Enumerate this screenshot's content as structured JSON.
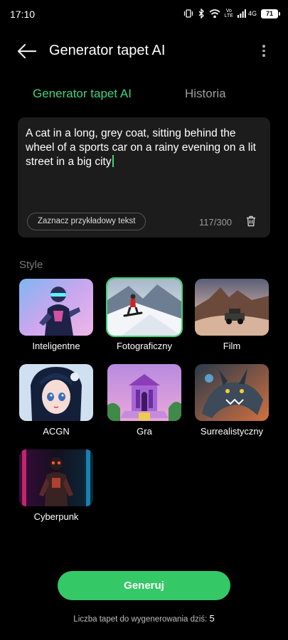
{
  "status_bar": {
    "time": "17:10",
    "volte": "Vo\nLTE",
    "network": "4G",
    "battery": "71"
  },
  "header": {
    "title": "Generator tapet AI"
  },
  "tabs": [
    {
      "label": "Generator tapet AI",
      "active": true
    },
    {
      "label": "Historia",
      "active": false
    }
  ],
  "prompt": {
    "text": "A cat in a long, grey coat, sitting behind the wheel of a sports car on a rainy evening on a lit street in a big city",
    "sample_button": "Zaznacz przykładowy tekst",
    "counter": "117/300"
  },
  "styles": {
    "label": "Style",
    "items": [
      {
        "name": "Inteligentne",
        "icon": "robot-thumbnail",
        "selected": false
      },
      {
        "name": "Fotograficzny",
        "icon": "snowboarder-thumbnail",
        "selected": true
      },
      {
        "name": "Film",
        "icon": "jeep-desert-thumbnail",
        "selected": false
      },
      {
        "name": "ACGN",
        "icon": "anime-girl-thumbnail",
        "selected": false
      },
      {
        "name": "Gra",
        "icon": "temple-thumbnail",
        "selected": false
      },
      {
        "name": "Surrealistyczny",
        "icon": "dragon-thumbnail",
        "selected": false
      },
      {
        "name": "Cyberpunk",
        "icon": "cyber-figure-thumbnail",
        "selected": false
      }
    ]
  },
  "generate": {
    "label": "Generuj",
    "quota_label": "Liczba tapet do wygenerowania dziś:",
    "quota_value": "5"
  },
  "colors": {
    "accent": "#3dd57b",
    "button": "#35c866",
    "background": "#000000",
    "card": "#1c1c1c"
  }
}
